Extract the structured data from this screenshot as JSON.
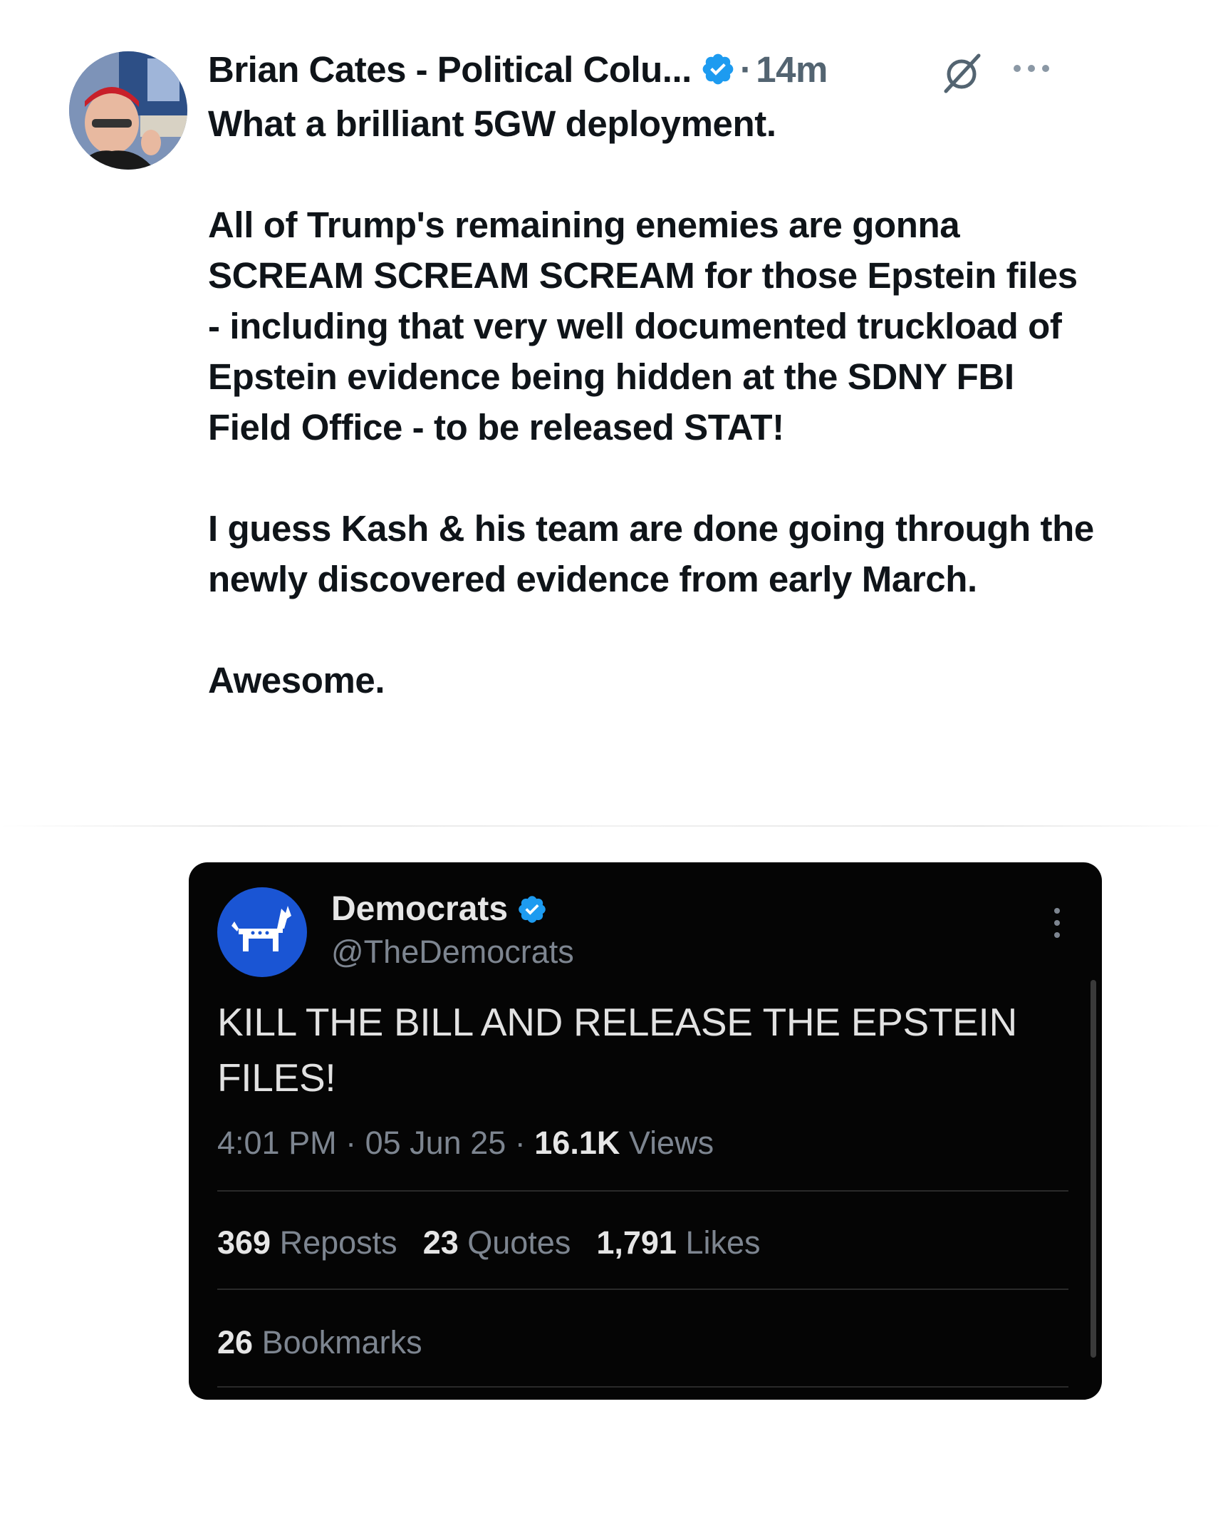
{
  "tweet": {
    "author": "Brian Cates - Political Colu...",
    "separator": "·",
    "timestamp": "14m",
    "paragraphs": [
      "What a brilliant 5GW deployment.",
      "All of Trump's remaining enemies are gonna SCREAM SCREAM SCREAM for those Epstein files - including that  very well documented truckload of Epstein evidence being hidden at the SDNY FBI Field Office - to be released STAT!",
      "I guess Kash & his team are done going through the newly discovered evidence from early March.",
      "Awesome."
    ]
  },
  "quoted": {
    "name": "Democrats",
    "handle": "@TheDemocrats",
    "text": "KILL THE BILL AND RELEASE THE EPSTEIN FILES!",
    "time": "4:01 PM",
    "dot1": " · ",
    "date": "05 Jun 25",
    "dot2": " · ",
    "views_count": "16.1K",
    "views_label": " Views",
    "reposts_count": "369",
    "reposts_label": " Reposts",
    "quotes_count": "23",
    "quotes_label": " Quotes",
    "likes_count": "1,791",
    "likes_label": " Likes",
    "bookmarks_count": "26",
    "bookmarks_label": " Bookmarks"
  },
  "icons": {
    "verified": "verified-badge-icon",
    "grok": "grok-icon",
    "more": "more-options-icon",
    "quoted_avatar": "donkey-logo-icon"
  },
  "colors": {
    "verified_blue": "#1d9bf0",
    "text_primary": "#0f1419",
    "text_secondary": "#536471",
    "democrats_blue": "#1a55d4"
  }
}
